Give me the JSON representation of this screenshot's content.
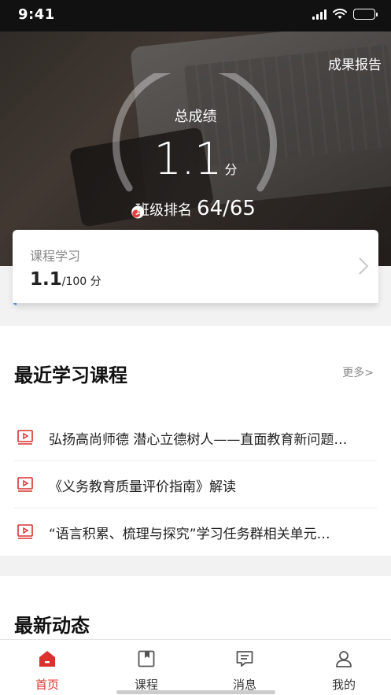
{
  "status_bar": {
    "time": "9:41"
  },
  "hero": {
    "report_link": "成果报告",
    "score_title": "总成绩",
    "score_value": "1.1",
    "score_unit": "分",
    "rank_label": "班级排名",
    "rank_value": "64/65",
    "score_ratio": 0.011
  },
  "course_study": {
    "label": "课程学习",
    "value": "1.1",
    "suffix": "/100 分",
    "progress": 0.011
  },
  "recent_courses": {
    "title": "最近学习课程",
    "more_label": "更多>",
    "items": [
      {
        "title": "弘扬高尚师德 潜心立德树人——直面教育新问题…"
      },
      {
        "title": "《义务教育质量评价指南》解读"
      },
      {
        "title": "“语言积累、梳理与探究”学习任务群相关单元…"
      }
    ]
  },
  "news": {
    "title": "最新动态"
  },
  "tabbar": {
    "tabs": [
      {
        "label": "首页",
        "icon": "home-icon",
        "active": true
      },
      {
        "label": "课程",
        "icon": "bookmark-book-icon",
        "active": false
      },
      {
        "label": "消息",
        "icon": "message-icon",
        "active": false
      },
      {
        "label": "我的",
        "icon": "user-icon",
        "active": false
      }
    ]
  },
  "colors": {
    "accent": "#d9322e",
    "progress": "#4a90d9"
  }
}
